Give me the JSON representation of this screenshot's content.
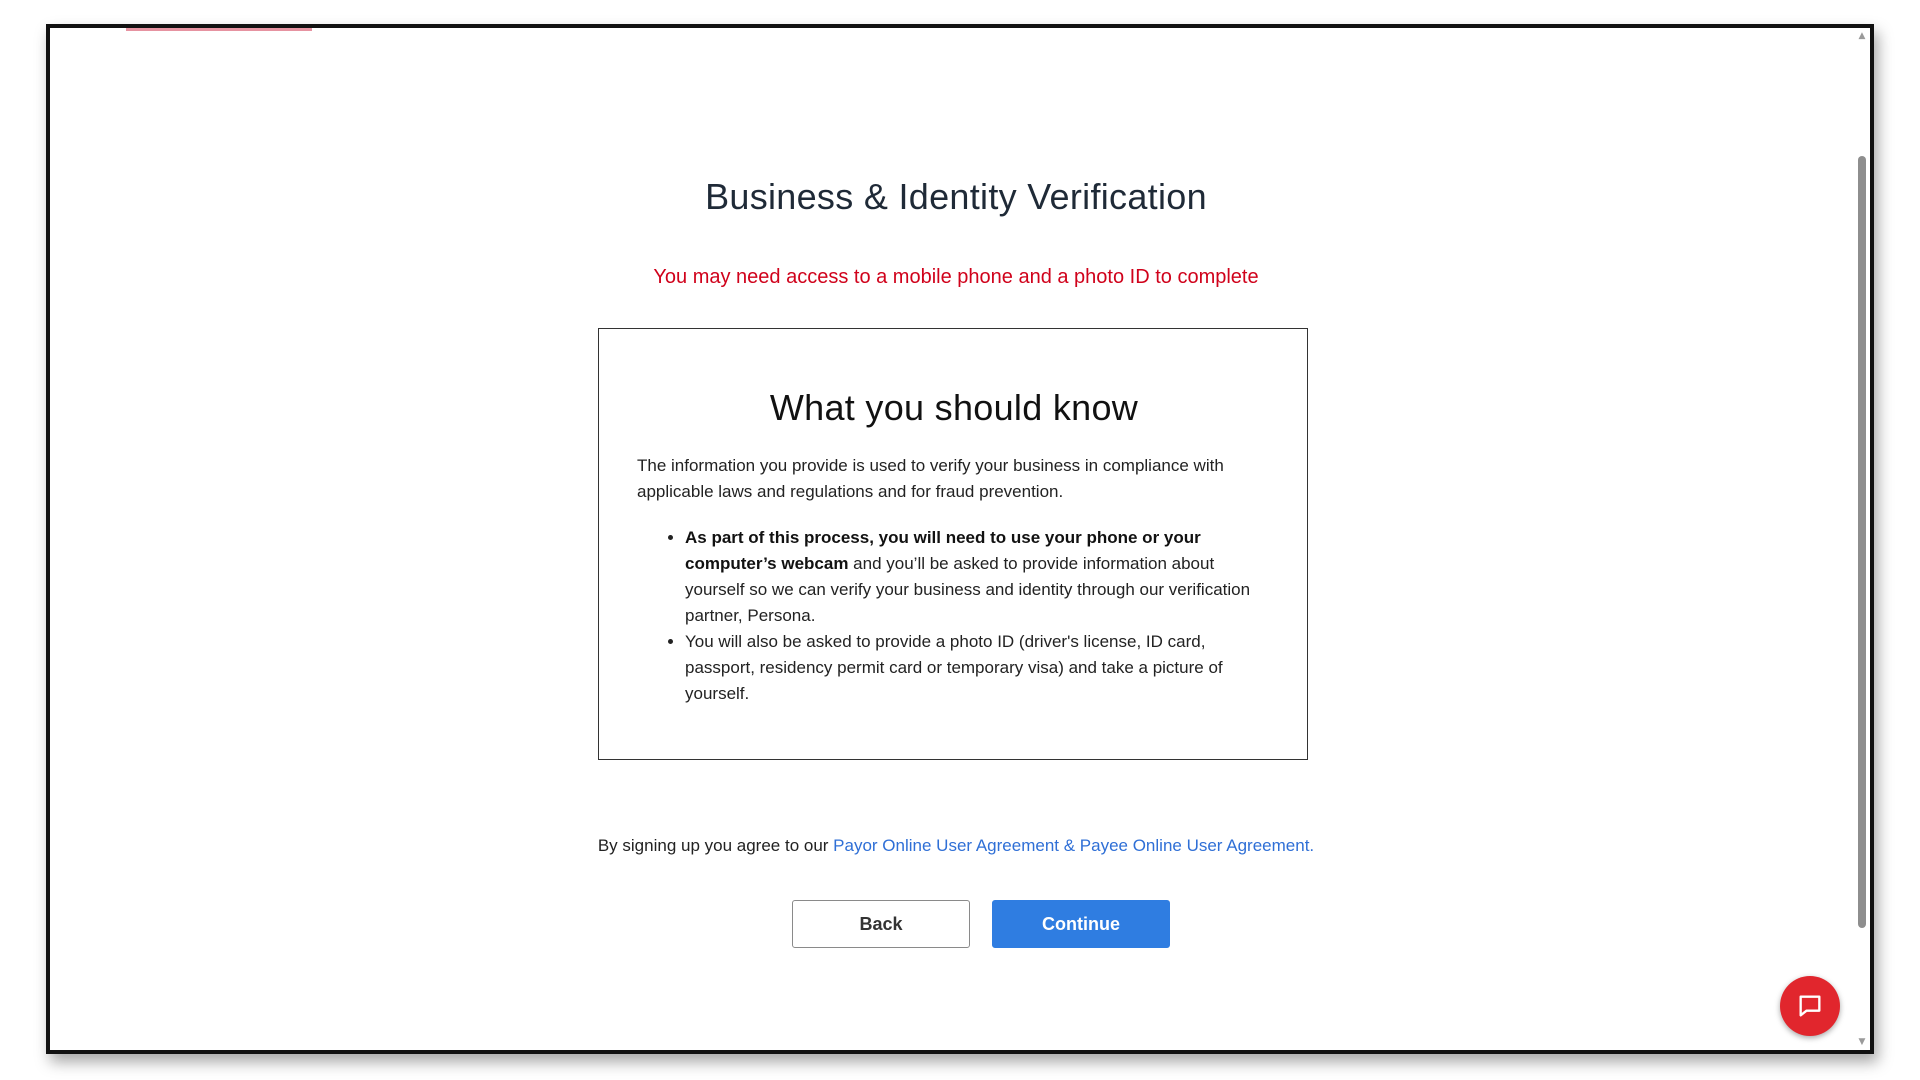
{
  "page": {
    "title": "Business & Identity Verification",
    "warning": "You may need access to a mobile phone and a photo ID to complete"
  },
  "info_card": {
    "heading": "What you should know",
    "intro": "The information you provide is used to verify your business in compliance with applicable laws and regulations and for fraud prevention.",
    "bullet1_bold": "As part of this process, you will need to use your phone or your computer’s webcam",
    "bullet1_rest": " and you’ll be asked to provide information about yourself so we can verify your business and identity through our verification partner, Persona.",
    "bullet2": "You will also be asked to provide a photo ID (driver's license, ID card, passport, residency permit card or temporary visa) and take a picture of yourself."
  },
  "agreement": {
    "prefix": "By signing up you agree to our ",
    "link_text": "Payor Online User Agreement & Payee Online User Agreement."
  },
  "buttons": {
    "back": "Back",
    "continue": "Continue"
  },
  "chat": {
    "icon": "chat-bubble-icon"
  },
  "colors": {
    "warning": "#d0021b",
    "primary": "#2f7de1",
    "link": "#2f6fd6",
    "chat": "#e1262d"
  }
}
